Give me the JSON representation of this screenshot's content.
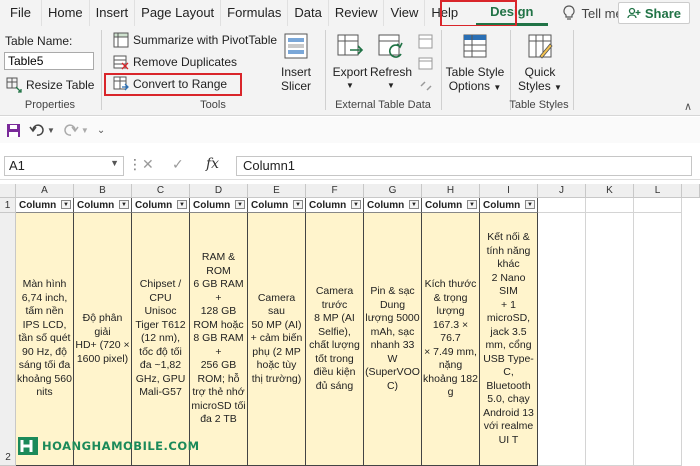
{
  "menu": {
    "tabs": [
      "File",
      "Home",
      "Insert",
      "Page Layout",
      "Formulas",
      "Data",
      "Review",
      "View",
      "Help"
    ],
    "active_tab": "Design",
    "tell_me": "Tell me",
    "share": "Share"
  },
  "ribbon": {
    "properties": {
      "table_name_label": "Table Name:",
      "table_name_value": "Table5",
      "resize_table": "Resize Table",
      "group_label": "Properties"
    },
    "tools": {
      "summarize_pivot": "Summarize with PivotTable",
      "remove_duplicates": "Remove Duplicates",
      "convert_to_range": "Convert to Range",
      "insert_slicer_line1": "Insert",
      "insert_slicer_line2": "Slicer",
      "group_label": "Tools"
    },
    "external": {
      "export": "Export",
      "refresh": "Refresh",
      "group_label": "External Table Data"
    },
    "table_styles": {
      "style_options_line1": "Table Style",
      "style_options_line2": "Options",
      "quick_styles_line1": "Quick",
      "quick_styles_line2": "Styles",
      "group_label": "Table Styles"
    }
  },
  "formula_bar": {
    "name_box": "A1",
    "cancel": "✕",
    "enter": "✓",
    "fx": "fx",
    "formula": "Column1"
  },
  "sheet": {
    "columns": [
      "A",
      "B",
      "C",
      "D",
      "E",
      "F",
      "G",
      "H",
      "I",
      "J",
      "K",
      "L"
    ],
    "rows": [
      "1",
      "2"
    ],
    "header_cells": [
      "Column",
      "Column",
      "Column",
      "Column",
      "Column",
      "Column",
      "Column",
      "Column",
      "Column"
    ],
    "data_cells": [
      "Màn hình\n6,74 inch,\ntấm nền\nIPS LCD,\ntần số quét\n90 Hz, độ\nsáng tối đa\nkhoảng 560\nnits",
      "Độ phân\ngiải\nHD+ (720 ×\n1600 pixel)",
      "Chipset /\nCPU\nUnisoc\nTiger T612\n(12 nm),\ntốc độ tối\nđa ~1,82\nGHz, GPU\nMali-G57",
      "RAM &\nROM\n6 GB RAM +\n128 GB\nROM hoặc\n8 GB RAM +\n256 GB\nROM; hỗ\ntrợ thẻ nhớ\nmicroSD tối\nđa 2 TB",
      "Camera sau\n50 MP (AI)\n+ cảm biến\nphụ (2 MP\nhoặc tùy\nthị trường)",
      "Camera\ntrước\n8 MP (AI\nSelfie),\nchất lượng\ntốt trong\nđiều kiện\nđủ sáng",
      "Pin & sạc\nDung\nlượng 5000\nmAh, sạc\nnhanh 33\nW\n(SuperVOO\nC)",
      "Kích thước\n& trọng\nlượng\n167.3 × 76.7\n× 7.49 mm,\nnặng\nkhoảng 182\ng",
      "Kết nối &\ntính năng\nkhác\n2 Nano SIM\n+ 1\nmicroSD,\njack 3.5\nmm, cổng\nUSB Type-\nC,\nBluetooth\n5.0, chạy\nAndroid 13\nvới realme\nUI T"
    ]
  },
  "watermark": "HOANGHAMOBILE.COM",
  "colors": {
    "excel_green": "#217346",
    "highlight_red": "#d9252a",
    "table_fill": "#fff4cc"
  }
}
